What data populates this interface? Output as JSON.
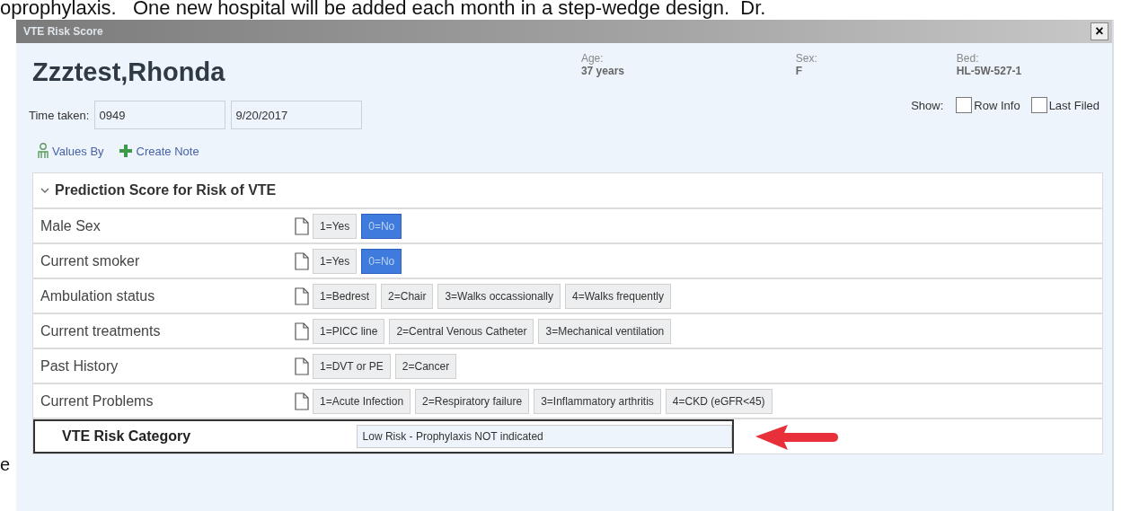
{
  "document_text": "oprophylaxis.   One new hospital will be added each month in a step-wedge design.  Dr.",
  "margin_text": "e",
  "window": {
    "title": "VTE Risk Score",
    "close": "×"
  },
  "patient": {
    "name": "Zzztest,Rhonda",
    "fields": [
      {
        "label": "Age:",
        "value": "37 years"
      },
      {
        "label": "Sex:",
        "value": "F"
      },
      {
        "label": "Bed:",
        "value": "HL-5W-527-1"
      }
    ]
  },
  "time_taken": {
    "label": "Time taken:",
    "time": "0949",
    "date": "9/20/2017"
  },
  "show": {
    "label": "Show:",
    "options": [
      {
        "label": "Row Info",
        "checked": false
      },
      {
        "label": "Last Filed",
        "checked": false
      }
    ]
  },
  "actions": [
    {
      "kind": "person",
      "label": "Values By"
    },
    {
      "kind": "add",
      "label": "Create Note"
    }
  ],
  "section": {
    "title": "Prediction Score for Risk of VTE",
    "expanded": true,
    "rows": [
      {
        "label": "Male Sex",
        "options": [
          {
            "label": "1=Yes",
            "selected": false
          },
          {
            "label": "0=No",
            "selected": true
          }
        ]
      },
      {
        "label": "Current smoker",
        "options": [
          {
            "label": "1=Yes",
            "selected": false
          },
          {
            "label": "0=No",
            "selected": true
          }
        ]
      },
      {
        "label": "Ambulation status",
        "options": [
          {
            "label": "1=Bedrest",
            "selected": false
          },
          {
            "label": "2=Chair",
            "selected": false
          },
          {
            "label": "3=Walks occassionally",
            "selected": false
          },
          {
            "label": "4=Walks frequently",
            "selected": false
          }
        ]
      },
      {
        "label": "Current treatments",
        "options": [
          {
            "label": "1=PICC line",
            "selected": false
          },
          {
            "label": "2=Central Venous Catheter",
            "selected": false
          },
          {
            "label": "3=Mechanical ventilation",
            "selected": false
          }
        ]
      },
      {
        "label": "Past History",
        "options": [
          {
            "label": "1=DVT or PE",
            "selected": false
          },
          {
            "label": "2=Cancer",
            "selected": false
          }
        ]
      },
      {
        "label": "Current Problems",
        "options": [
          {
            "label": "1=Acute Infection",
            "selected": false
          },
          {
            "label": "2=Respiratory failure",
            "selected": false
          },
          {
            "label": "3=Inflammatory arthritis",
            "selected": false
          },
          {
            "label": "4=CKD (eGFR<45)",
            "selected": false
          }
        ]
      }
    ],
    "result": {
      "label": "VTE Risk Category",
      "value": "Low Risk - Prophylaxis NOT indicated"
    }
  }
}
